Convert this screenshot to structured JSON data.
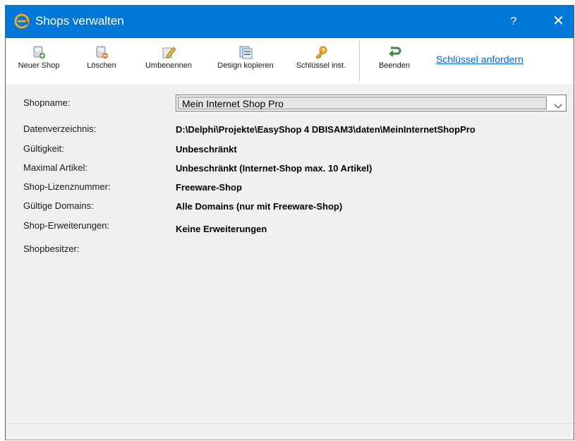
{
  "window": {
    "title": "Shops verwalten",
    "help": "?",
    "close": "✕"
  },
  "toolbar": {
    "new_shop": "Neuer Shop",
    "delete": "Löschen",
    "rename": "Umbenennen",
    "copy_design": "Design kopieren",
    "install_key": "Schlüssel inst.",
    "exit": "Beenden",
    "request_key": "Schlüssel anfordern"
  },
  "form": {
    "shopname_label": "Shopname:",
    "shopname_value": "Mein Internet Shop Pro",
    "datadir_label": "Datenverzeichnis:",
    "datadir_value": "D:\\Delphi\\Projekte\\EasyShop 4 DBISAM3\\daten\\MeinInternetShopPro",
    "validity_label": "Gültigkeit:",
    "validity_value": "Unbeschränkt",
    "max_articles_label": "Maximal Artikel:",
    "max_articles_value": "Unbeschränkt (Internet-Shop max. 10 Artikel)",
    "license_label": "Shop-Lizenznummer:",
    "license_value": "Freeware-Shop",
    "domains_label": "Gültige Domains:",
    "domains_value": "Alle Domains (nur mit Freeware-Shop)",
    "extensions_label": "Shop-Erweiterungen:",
    "extensions_value": "Keine Erweiterungen",
    "owner_label": "Shopbesitzer:"
  },
  "colors": {
    "titlebar": "#0078d7",
    "link": "#0066cc",
    "dialog_bg": "#f0f0f0"
  }
}
